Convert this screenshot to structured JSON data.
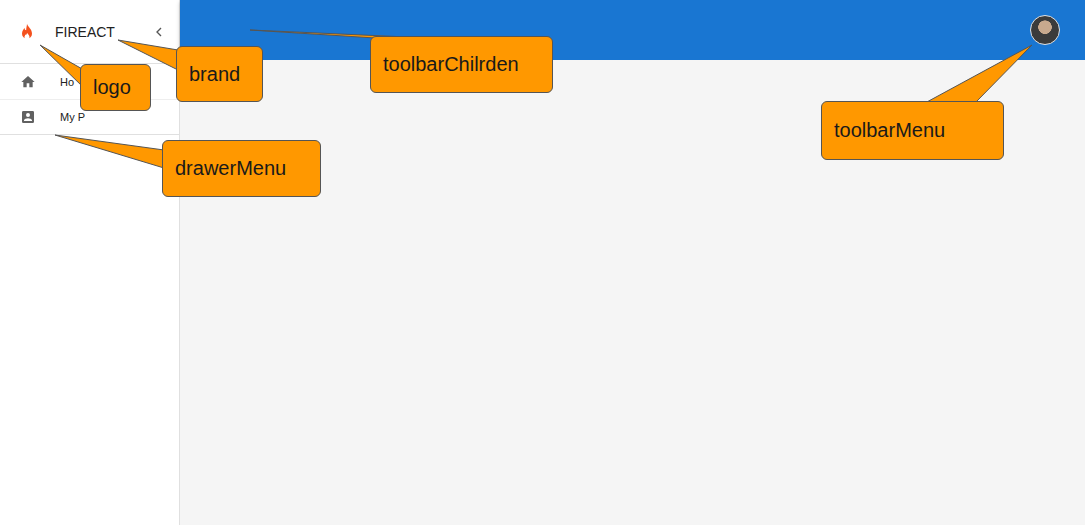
{
  "drawer": {
    "brand": "FIREACT",
    "items": [
      {
        "label": "Ho"
      },
      {
        "label": "My P"
      }
    ]
  },
  "toolbar": {
    "avatar": "photo"
  },
  "annotations": [
    {
      "label": "logo"
    },
    {
      "label": "brand"
    },
    {
      "label": "toolbarChilrden"
    },
    {
      "label": "toolbarMenu"
    },
    {
      "label": "drawerMenu"
    }
  ]
}
